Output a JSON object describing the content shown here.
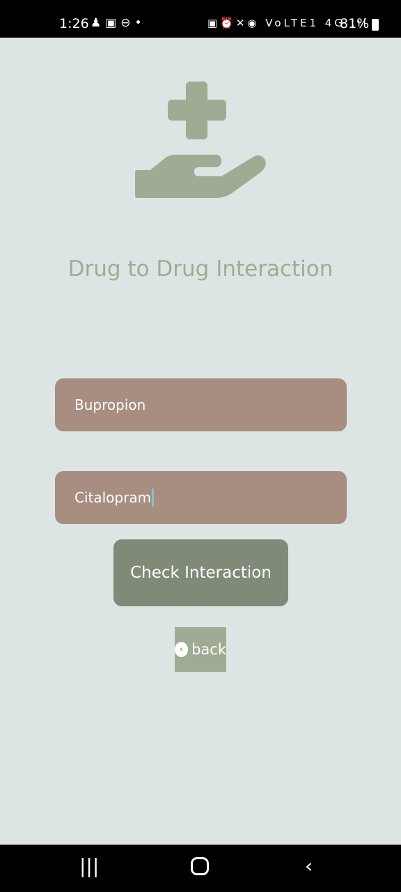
{
  "status_bar": {
    "time": "1:26",
    "left_icons": "snapchat-icon gallery-icon dnd-icon dot",
    "battery": "81%",
    "network": "VoLTE1 4G"
  },
  "title": "Drug to Drug Interaction",
  "drug1": {
    "value": "Bupropion"
  },
  "drug2": {
    "value": "Citalopram"
  },
  "check_label": "Check Interaction",
  "back_label": "back",
  "colors": {
    "background": "#dce5e4",
    "accent": "#9fac93",
    "field": "#a88e81",
    "button": "#7f8a78"
  }
}
